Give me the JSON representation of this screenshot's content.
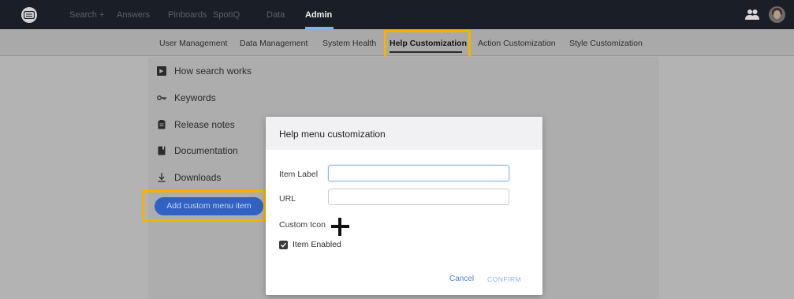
{
  "topnav": {
    "items": [
      {
        "label": "Search"
      },
      {
        "label": "Answers"
      },
      {
        "label": "Pinboards"
      },
      {
        "label": "SpotIQ"
      },
      {
        "label": "Data"
      },
      {
        "label": "Admin"
      }
    ],
    "active": "Admin"
  },
  "subnav": {
    "items": [
      {
        "label": "User Management"
      },
      {
        "label": "Data Management"
      },
      {
        "label": "System Health"
      },
      {
        "label": "Help Customization"
      },
      {
        "label": "Action Customization"
      },
      {
        "label": "Style Customization"
      }
    ],
    "active": "Help Customization"
  },
  "help_menu": {
    "items": [
      {
        "label": "How search works",
        "icon": "video-icon"
      },
      {
        "label": "Keywords",
        "icon": "key-icon"
      },
      {
        "label": "Release notes",
        "icon": "notes-icon"
      },
      {
        "label": "Documentation",
        "icon": "book-icon"
      },
      {
        "label": "Downloads",
        "icon": "download-icon"
      }
    ],
    "add_button": "Add custom menu item"
  },
  "modal": {
    "title": "Help menu customization",
    "fields": {
      "item_label": {
        "label": "Item Label",
        "value": ""
      },
      "url": {
        "label": "URL",
        "value": ""
      },
      "custom_icon": {
        "label": "Custom Icon"
      }
    },
    "item_enabled": {
      "label": "Item Enabled",
      "checked": true
    },
    "cancel": "Cancel",
    "confirm": "CONFIRM"
  },
  "colors": {
    "highlight": "#f5b301",
    "primary_button": "#2f62c2",
    "topnav_bg": "#1a1e26",
    "link": "#4a86d6"
  }
}
